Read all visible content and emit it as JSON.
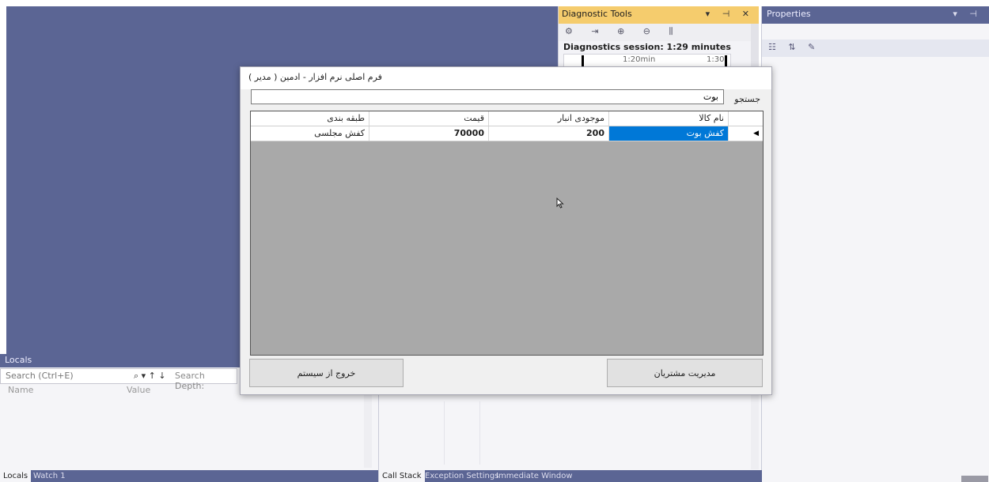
{
  "diagnostic_tools": {
    "title": "Diagnostic Tools",
    "controls": "▾ ⊣ ✕",
    "toolbar_icons": [
      "gear-icon",
      "export-icon",
      "zoom-in-icon",
      "zoom-out-icon",
      "chart-icon"
    ],
    "toolbar_glyphs": "⚙ ⇥ ⊕ ⊖ ⫼",
    "session": "Diagnostics session: 1:29 minutes",
    "tick_1": "1:20min",
    "tick_2": "1:30"
  },
  "properties": {
    "title": "Properties",
    "controls": "▾ ⊣",
    "toolbar_glyphs": "☷ ⇅ ✎"
  },
  "locals": {
    "title": "Locals",
    "search_placeholder": "Search (Ctrl+E)",
    "search_icons": "⌕ ▾  ↑  ↓",
    "search_depth": "Search Depth:",
    "col_name": "Name",
    "col_value": "Value",
    "tabs": [
      "Locals",
      "Watch 1"
    ]
  },
  "callstack": {
    "tabs": [
      "Call Stack",
      "Exception Settings",
      "Immediate Window"
    ]
  },
  "form": {
    "title": "فرم اصلی نرم افزار - ادمین ( مدیر )",
    "search_label": "جستجو",
    "search_value": "بوت",
    "grid": {
      "headers": [
        "نام کالا",
        "موجودی انبار",
        "قیمت",
        "طبقه بندی"
      ],
      "rows": [
        {
          "name": "کفش بوت",
          "stock": "200",
          "price": "70000",
          "category": "کفش مجلسی"
        }
      ]
    },
    "btn_customers": "مدیریت مشتریان",
    "btn_exit": "خروج از سیستم"
  }
}
